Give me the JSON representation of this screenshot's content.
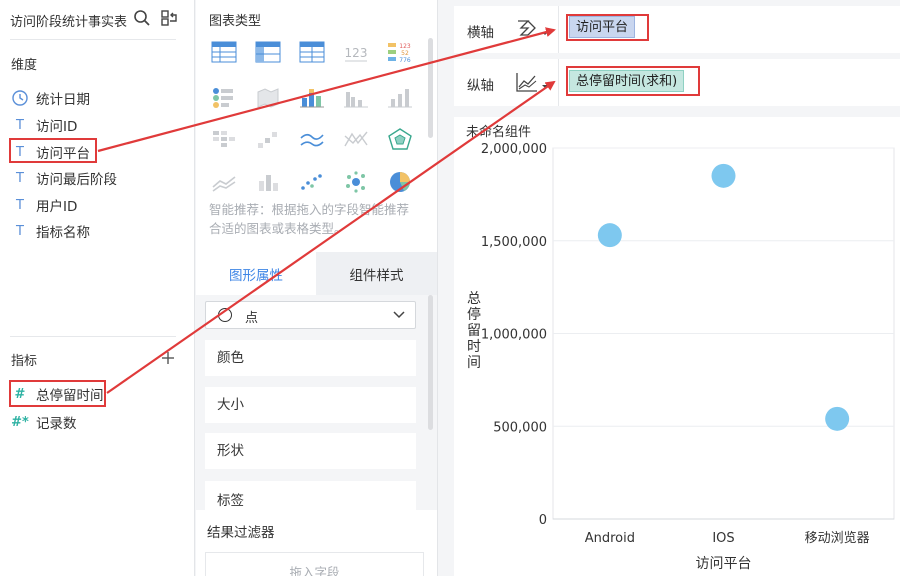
{
  "dataset": {
    "title": "访问阶段统计事实表",
    "dimensions_label": "维度",
    "dimensions": [
      {
        "icon": "clock-icon",
        "label": "统计日期"
      },
      {
        "icon": "text-type-icon",
        "label": "访问ID"
      },
      {
        "icon": "text-type-icon",
        "label": "访问平台"
      },
      {
        "icon": "text-type-icon",
        "label": "访问最后阶段"
      },
      {
        "icon": "text-type-icon",
        "label": "用户ID"
      },
      {
        "icon": "text-type-icon",
        "label": "指标名称"
      }
    ],
    "metrics_label": "指标",
    "metrics": [
      {
        "icon": "hash-icon",
        "label": "总停留时间"
      },
      {
        "icon": "hash-star-icon",
        "label": "记录数"
      }
    ]
  },
  "config": {
    "chart_type_label": "图表类型",
    "smart_tip": "智能推荐：根据拖入的字段智能推荐合适的图表或表格类型。",
    "tabs": [
      "图形属性",
      "组件样式"
    ],
    "shape_value": "点",
    "props": [
      "颜色",
      "大小",
      "形状",
      "标签"
    ],
    "filter_title": "结果过滤器",
    "filter_placeholder": "拖入字段"
  },
  "axes": {
    "x_label": "横轴",
    "x_field": "访问平台",
    "y_label": "纵轴",
    "y_field": "总停留时间(求和)"
  },
  "widget": {
    "title": "未命名组件"
  },
  "colors": {
    "accent": "#3f86e6",
    "highlight": "#e03a3a",
    "dot": "#7ec8ef",
    "pill_blue": "#c9d6ef",
    "pill_green": "#c5e7e0"
  },
  "chart_data": {
    "type": "scatter",
    "categories": [
      "Android",
      "IOS",
      "移动浏览器"
    ],
    "values": [
      1530000,
      1850000,
      540000
    ],
    "xlabel": "访问平台",
    "ylabel": "总停留时间",
    "ylim": [
      0,
      2000000
    ],
    "yticks": [
      "0",
      "500,000",
      "1,000,000",
      "1,500,000",
      "2,000,000"
    ],
    "grid": true
  }
}
